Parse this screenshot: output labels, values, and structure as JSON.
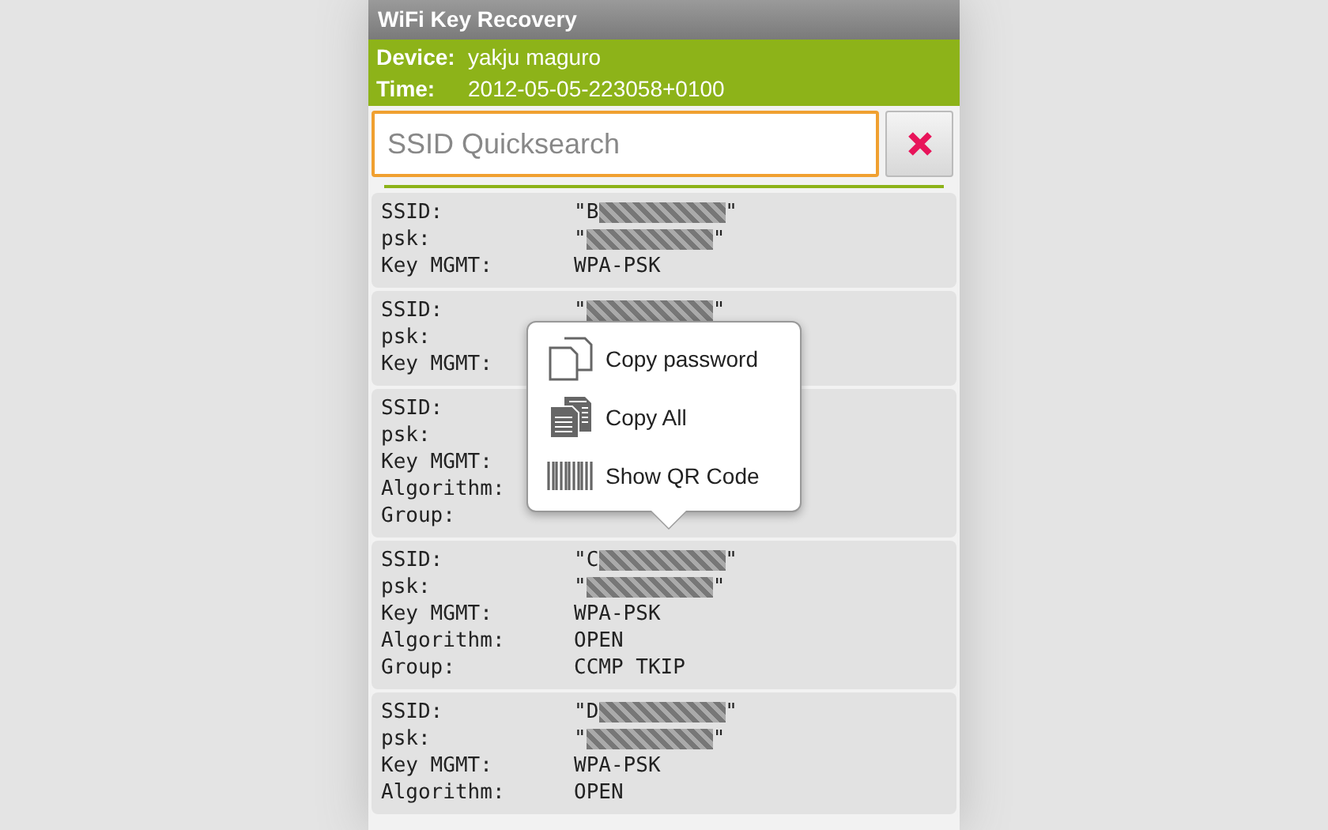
{
  "app": {
    "title": "WiFi Key Recovery"
  },
  "header": [
    {
      "label": "Device:",
      "value": "yakju maguro"
    },
    {
      "label": "Time:",
      "value": "2012-05-05-223058+0100"
    }
  ],
  "search": {
    "placeholder": "SSID Quicksearch",
    "focused": true
  },
  "networks": [
    {
      "fields": [
        {
          "label": "SSID:",
          "value": "\"B",
          "redacted": true,
          "closing": "\""
        },
        {
          "label": "psk:",
          "value": "\"",
          "redacted": true,
          "closing": "\""
        },
        {
          "label": "Key MGMT:",
          "value": "WPA-PSK",
          "redacted": false
        }
      ]
    },
    {
      "fields": [
        {
          "label": "SSID:",
          "value": "\"",
          "redacted": true,
          "closing": "\""
        },
        {
          "label": "psk:"
        },
        {
          "label": "Key MGMT:"
        }
      ]
    },
    {
      "fields": [
        {
          "label": "SSID:"
        },
        {
          "label": "psk:"
        },
        {
          "label": "Key MGMT:"
        },
        {
          "label": "Algorithm:"
        },
        {
          "label": "Group:"
        }
      ]
    },
    {
      "fields": [
        {
          "label": "SSID:",
          "value": "\"C",
          "redacted": true,
          "closing": "\""
        },
        {
          "label": "psk:",
          "value": "\"",
          "redacted": true,
          "closing": "\""
        },
        {
          "label": "Key MGMT:",
          "value": "WPA-PSK",
          "redacted": false
        },
        {
          "label": "Algorithm:",
          "value": "OPEN",
          "redacted": false
        },
        {
          "label": "Group:",
          "value": "CCMP TKIP",
          "redacted": false
        }
      ]
    },
    {
      "fields": [
        {
          "label": "SSID:",
          "value": "\"D",
          "redacted": true,
          "closing": "\""
        },
        {
          "label": "psk:",
          "value": "\"",
          "redacted": true,
          "closing": "\""
        },
        {
          "label": "Key MGMT:",
          "value": "WPA-PSK",
          "redacted": false
        },
        {
          "label": "Algorithm:",
          "value": "OPEN",
          "redacted": false
        }
      ]
    }
  ],
  "context_menu": [
    {
      "kind": "copy",
      "label": "Copy password"
    },
    {
      "kind": "copy-all",
      "label": "Copy All"
    },
    {
      "kind": "qr",
      "label": "Show QR Code"
    }
  ]
}
